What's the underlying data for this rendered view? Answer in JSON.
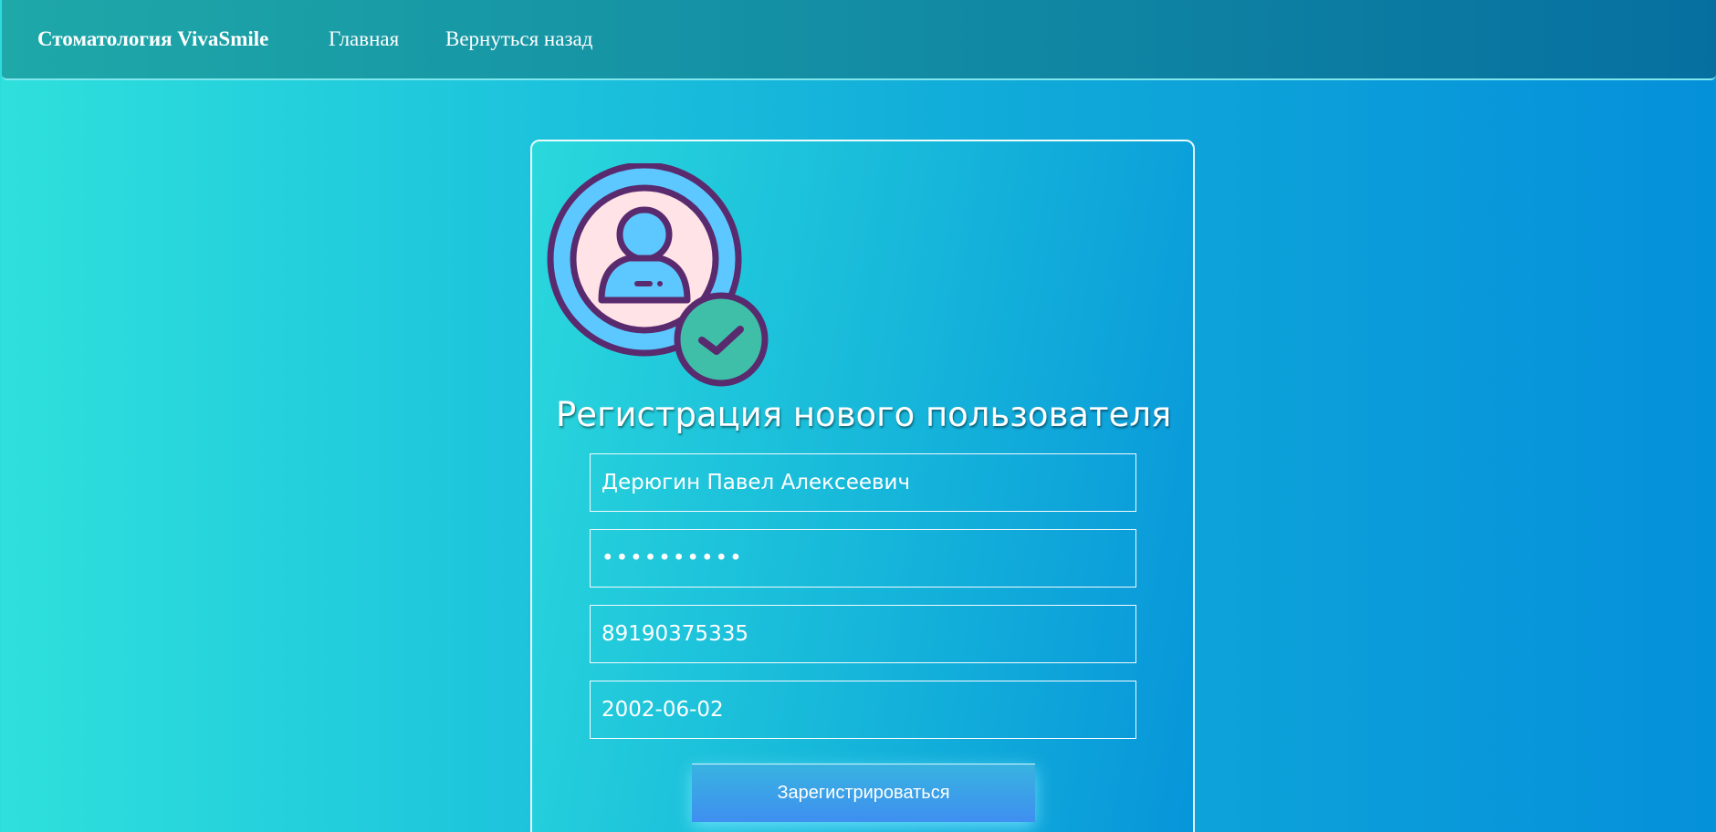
{
  "navbar": {
    "brand": "Стоматология VivaSmile",
    "links": [
      "Главная",
      "Вернуться назад"
    ]
  },
  "form": {
    "title": "Регистрация нового пользователя",
    "fields": [
      {
        "name": "full_name",
        "value": "Дерюгин Павел Алексеевич",
        "type": "text"
      },
      {
        "name": "password",
        "value": "••••••••••",
        "type": "password"
      },
      {
        "name": "phone",
        "value": "89190375335",
        "type": "text"
      },
      {
        "name": "birth_date",
        "value": "2002-06-02",
        "type": "text"
      }
    ],
    "submit_label": "Зарегистрироваться"
  },
  "icons": {
    "avatar": "user-verified-icon"
  },
  "colors": {
    "navbar_start": "#1ea8a8",
    "navbar_end": "#066fa0",
    "page_bg_start": "#2ee0dc",
    "page_bg_end": "#0590da",
    "button_start": "#38b3e0",
    "button_end": "#3f8ff0",
    "avatar_outline": "#5a2a6e",
    "avatar_blue": "#5cc8ff",
    "avatar_pink": "#ffe3e6",
    "check_green": "#3fbfa8"
  }
}
